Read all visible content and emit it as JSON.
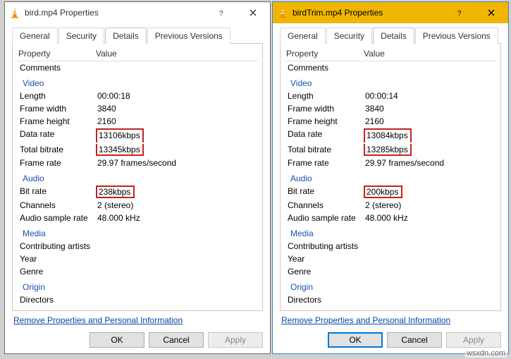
{
  "watermark": "wsxdn.com",
  "left": {
    "title": "bird.mp4 Properties",
    "active": false,
    "tabs": [
      "General",
      "Security",
      "Details",
      "Previous Versions"
    ],
    "active_tab": "Details",
    "header": {
      "property": "Property",
      "value": "Value"
    },
    "sections": [
      {
        "name": "Video",
        "rows": [
          {
            "label": "Length",
            "value": "00:00:18"
          },
          {
            "label": "Frame width",
            "value": "3840"
          },
          {
            "label": "Frame height",
            "value": "2160"
          },
          {
            "label": "Data rate",
            "value": "13106kbps",
            "hl": "g1"
          },
          {
            "label": "Total bitrate",
            "value": "13345kbps",
            "hl": "g1"
          },
          {
            "label": "Frame rate",
            "value": "29.97 frames/second"
          }
        ]
      },
      {
        "name": "Audio",
        "rows": [
          {
            "label": "Bit rate",
            "value": "238kbps",
            "hl": "single"
          },
          {
            "label": "Channels",
            "value": "2 (stereo)"
          },
          {
            "label": "Audio sample rate",
            "value": "48.000 kHz"
          }
        ]
      },
      {
        "name": "Media",
        "rows": [
          {
            "label": "Contributing artists",
            "value": ""
          },
          {
            "label": "Year",
            "value": ""
          },
          {
            "label": "Genre",
            "value": ""
          }
        ]
      },
      {
        "name": "Origin",
        "rows": [
          {
            "label": "Directors",
            "value": ""
          }
        ]
      }
    ],
    "remove_link": "Remove Properties and Personal Information",
    "buttons": {
      "ok": "OK",
      "cancel": "Cancel",
      "apply": "Apply"
    }
  },
  "right": {
    "title": "birdTrim.mp4 Properties",
    "active": true,
    "tabs": [
      "General",
      "Security",
      "Details",
      "Previous Versions"
    ],
    "active_tab": "Details",
    "header": {
      "property": "Property",
      "value": "Value"
    },
    "sections": [
      {
        "name": "Video",
        "rows": [
          {
            "label": "Length",
            "value": "00:00:14"
          },
          {
            "label": "Frame width",
            "value": "3840"
          },
          {
            "label": "Frame height",
            "value": "2160"
          },
          {
            "label": "Data rate",
            "value": "13084kbps",
            "hl": "g1"
          },
          {
            "label": "Total bitrate",
            "value": "13285kbps",
            "hl": "g1"
          },
          {
            "label": "Frame rate",
            "value": "29.97 frames/second"
          }
        ]
      },
      {
        "name": "Audio",
        "rows": [
          {
            "label": "Bit rate",
            "value": "200kbps",
            "hl": "single"
          },
          {
            "label": "Channels",
            "value": "2 (stereo)"
          },
          {
            "label": "Audio sample rate",
            "value": "48.000 kHz"
          }
        ]
      },
      {
        "name": "Media",
        "rows": [
          {
            "label": "Contributing artists",
            "value": ""
          },
          {
            "label": "Year",
            "value": ""
          },
          {
            "label": "Genre",
            "value": ""
          }
        ]
      },
      {
        "name": "Origin",
        "rows": [
          {
            "label": "Directors",
            "value": ""
          }
        ]
      }
    ],
    "remove_link": "Remove Properties and Personal Information",
    "buttons": {
      "ok": "OK",
      "cancel": "Cancel",
      "apply": "Apply"
    }
  }
}
